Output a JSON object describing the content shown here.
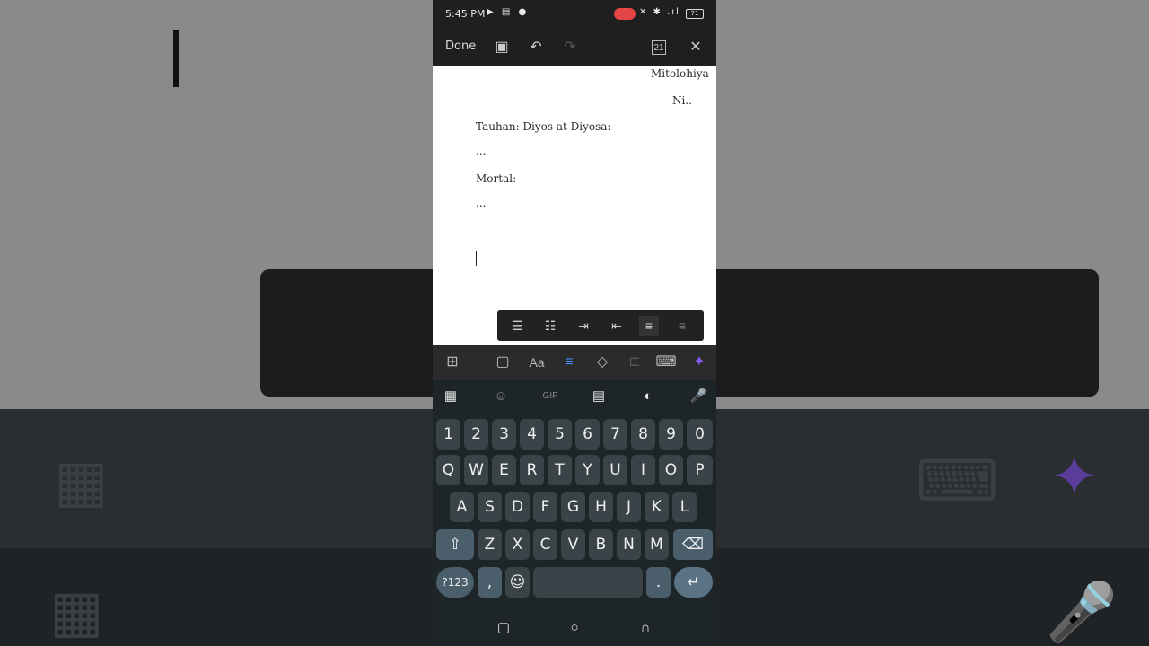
{
  "status": {
    "time": "5:45 PM",
    "left_icons": "▶ ▤ ●",
    "right_icons": "✕ ✱ .ıl",
    "battery": "71"
  },
  "toolbar": {
    "done_label": "Done",
    "page_count": "21",
    "save_icon": "▣",
    "undo_icon": "↶",
    "redo_icon": "↷",
    "close_icon": "✕"
  },
  "document": {
    "lines": [
      "Mitolohiya",
      "Ni..",
      "Tauhan: Diyos at Diyosa:",
      "...",
      "Mortal:",
      "..."
    ]
  },
  "format_bar": {
    "icons": [
      "☰",
      "☷",
      "⇥",
      "⇤",
      "≡",
      "≡"
    ]
  },
  "edit_tools": {
    "icons": [
      "⊞",
      "▢",
      "Aa",
      "≡",
      "◇",
      "⊏",
      "⌨",
      "✦"
    ]
  },
  "keyboard": {
    "tool_icons": [
      "▦",
      "☺",
      "GIF",
      "▤",
      "◐",
      "🎤"
    ],
    "row_numbers": [
      "1",
      "2",
      "3",
      "4",
      "5",
      "6",
      "7",
      "8",
      "9",
      "0"
    ],
    "row_top": [
      "Q",
      "W",
      "E",
      "R",
      "T",
      "Y",
      "U",
      "I",
      "O",
      "P"
    ],
    "row_mid": [
      "A",
      "S",
      "D",
      "F",
      "G",
      "H",
      "J",
      "K",
      "L"
    ],
    "row_low": [
      "Z",
      "X",
      "C",
      "V",
      "B",
      "N",
      "M"
    ],
    "shift": "⇧",
    "backspace": "⌫",
    "sym": "?123",
    "comma": ",",
    "emoji": "☺",
    "period": ".",
    "enter": "↵"
  },
  "nav": {
    "recents": "▢",
    "home": "○",
    "back": "∩"
  },
  "colors": {
    "accent_purple": "#8b5cf6",
    "accent_blue": "#4a8cff",
    "record_red": "#e64545"
  }
}
